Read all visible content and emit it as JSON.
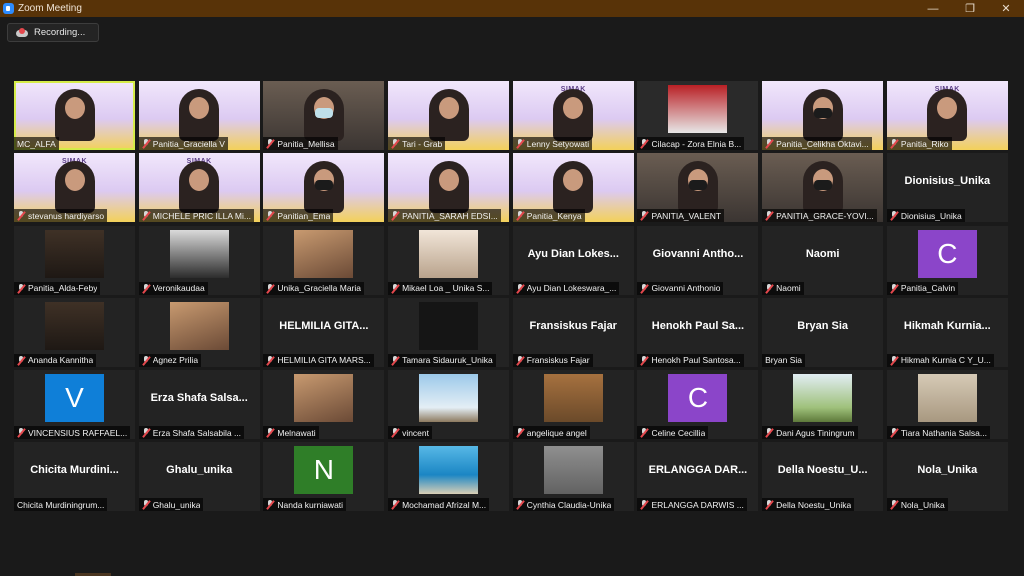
{
  "window": {
    "title": "Zoom Meeting",
    "minimize": "—",
    "restore": "❐",
    "close": "✕"
  },
  "recording": {
    "label": "Recording..."
  },
  "tiles": [
    {
      "name": "MC_ALFA",
      "display": "video",
      "bg": "banner",
      "active": true,
      "muted": false
    },
    {
      "name": "Panitia_Graciella V",
      "display": "video",
      "bg": "banner",
      "muted": true
    },
    {
      "name": "Panitia_Mellisa",
      "display": "video",
      "bg": "room",
      "mask": "blue",
      "muted": true
    },
    {
      "name": "Tari - Grab",
      "display": "video",
      "bg": "banner",
      "muted": true
    },
    {
      "name": "Lenny Setyowati",
      "display": "video",
      "bg": "banner",
      "banner": "SIMAK",
      "muted": true
    },
    {
      "name": "Cilacap - Zora Elnia B...",
      "display": "video",
      "bg": "dark",
      "photo": "suit",
      "muted": true
    },
    {
      "name": "Panitia_Celikha Oktavi...",
      "display": "video",
      "bg": "banner",
      "mask": "dark",
      "muted": true
    },
    {
      "name": "Panitia_Riko",
      "display": "video",
      "bg": "banner",
      "banner": "SIMAK",
      "muted": true
    },
    {
      "name": "stevanus hardiyarso",
      "display": "video",
      "bg": "banner",
      "banner": "SIMAK",
      "muted": true
    },
    {
      "name": "MICHELE PRIC ILLA Mi...",
      "display": "video",
      "bg": "banner",
      "banner": "SIMAK",
      "muted": true
    },
    {
      "name": "Panitian_Ema",
      "display": "video",
      "bg": "banner",
      "mask": "dark",
      "muted": true
    },
    {
      "name": "PANITIA_SARAH EDSI...",
      "display": "video",
      "bg": "banner",
      "muted": true
    },
    {
      "name": "Panitia_Kenya",
      "display": "video",
      "bg": "banner",
      "muted": true
    },
    {
      "name": "PANITIA_VALENT",
      "display": "video",
      "bg": "room",
      "mask": "dark",
      "muted": true
    },
    {
      "name": "PANITIA_GRACE-YOVI...",
      "display": "video",
      "bg": "room",
      "mask": "dark",
      "muted": true
    },
    {
      "name": "Dionisius_Unika",
      "display": "text",
      "big": "Dionisius_Unika",
      "muted": true
    },
    {
      "name": "Panitia_Alda-Feby",
      "display": "pic",
      "pic": "girl",
      "muted": true
    },
    {
      "name": "Veronikaudaa",
      "display": "pic",
      "pic": "tree",
      "muted": true
    },
    {
      "name": "Unika_Graciella Maria",
      "display": "pic",
      "pic": "warm",
      "muted": true
    },
    {
      "name": "Mikael Loa _ Unika S...",
      "display": "pic",
      "pic": "anime",
      "muted": true
    },
    {
      "name": "Ayu Dian Lokeswara_...",
      "display": "text",
      "big": "Ayu Dian Lokes...",
      "muted": true
    },
    {
      "name": "Giovanni Anthonio",
      "display": "text",
      "big": "Giovanni Antho...",
      "muted": true
    },
    {
      "name": "Naomi",
      "display": "text",
      "big": "Naomi",
      "muted": true
    },
    {
      "name": "Panitia_Calvin",
      "display": "letter",
      "avatar": "c",
      "letter": "C",
      "muted": true
    },
    {
      "name": "Ananda Kannitha",
      "display": "pic",
      "pic": "girl",
      "muted": true
    },
    {
      "name": "Agnez Prilia",
      "display": "pic",
      "pic": "warm",
      "muted": true
    },
    {
      "name": "HELMILIA GITA MARS...",
      "display": "text",
      "big": "HELMILIA GITA...",
      "muted": true
    },
    {
      "name": "Tamara Sidauruk_Unika",
      "display": "pic",
      "pic": "black",
      "muted": true
    },
    {
      "name": "Fransiskus Fajar",
      "display": "text",
      "big": "Fransiskus Fajar",
      "muted": true
    },
    {
      "name": "Henokh Paul Santosa...",
      "display": "text",
      "big": "Henokh Paul Sa...",
      "muted": true
    },
    {
      "name": "Bryan Sia",
      "display": "text",
      "big": "Bryan Sia",
      "muted": false
    },
    {
      "name": "Hikmah Kurnia C Y_U...",
      "display": "text",
      "big": "Hikmah Kurnia...",
      "muted": true
    },
    {
      "name": "VINCENSIUS RAFFAEL...",
      "display": "letter",
      "avatar": "v",
      "letter": "V",
      "muted": true
    },
    {
      "name": "Erza Shafa Salsabila ...",
      "display": "text",
      "big": "Erza Shafa Salsa...",
      "muted": true
    },
    {
      "name": "Melnawati",
      "display": "pic",
      "pic": "warm",
      "muted": true
    },
    {
      "name": "vincent",
      "display": "pic",
      "pic": "sky",
      "muted": true
    },
    {
      "name": "angelique angel",
      "display": "pic",
      "pic": "brown",
      "muted": true
    },
    {
      "name": "Celine Cecillia",
      "display": "letter",
      "avatar": "c",
      "letter": "C",
      "muted": true
    },
    {
      "name": "Dani Agus Tiningrum",
      "display": "pic",
      "pic": "field",
      "muted": true
    },
    {
      "name": "Tiara Nathania Salsa...",
      "display": "pic",
      "pic": "wall",
      "muted": true
    },
    {
      "name": "Chicita Murdiningrum...",
      "display": "text",
      "big": "Chicita Murdini...",
      "muted": false
    },
    {
      "name": "Ghalu_unika",
      "display": "text",
      "big": "Ghalu_unika",
      "muted": true
    },
    {
      "name": "Nanda kurniawati",
      "display": "letter",
      "avatar": "n",
      "letter": "N",
      "muted": true
    },
    {
      "name": "Mochamad Afrizal M...",
      "display": "pic",
      "pic": "sea",
      "muted": true
    },
    {
      "name": "Cynthia Claudia-Unika",
      "display": "pic",
      "pic": "gray",
      "muted": true
    },
    {
      "name": "ERLANGGA DARWIS ...",
      "display": "text",
      "big": "ERLANGGA DAR...",
      "muted": true
    },
    {
      "name": "Della Noestu_Unika",
      "display": "text",
      "big": "Della Noestu_U...",
      "muted": true
    },
    {
      "name": "Nola_Unika",
      "display": "text",
      "big": "Nola_Unika",
      "muted": true
    }
  ]
}
